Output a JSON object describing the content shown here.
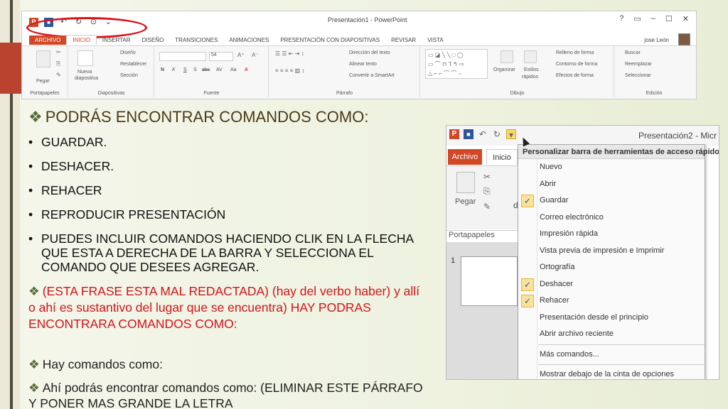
{
  "ribbon": {
    "qat_icons": [
      "ppt-icon",
      "save-icon",
      "undo-icon",
      "redo-icon",
      "present-icon",
      "customize-icon"
    ],
    "doc_title": "Presentación1 - PowerPoint",
    "window_controls": [
      "?",
      "▭",
      "–",
      "☐",
      "✕"
    ],
    "tabs": [
      "ARCHIVO",
      "INICIO",
      "INSERTAR",
      "DISEÑO",
      "TRANSICIONES",
      "ANIMACIONES",
      "PRESENTACIÓN CON DIAPOSITIVAS",
      "REVISAR",
      "VISTA"
    ],
    "user": "jose León",
    "groups": {
      "portapapeles": "Portapapeles",
      "diapositivas": "Diapositivas",
      "fuente": "Fuente",
      "parrafo": "Párrafo",
      "dibujo": "Dibujo",
      "edicion": "Edición"
    },
    "buttons": {
      "pegar": "Pegar",
      "nueva": "Nueva",
      "diapositiva": "diapositiva",
      "diseno": "Diseño",
      "restablecer": "Restablecer",
      "seccion": "Sección",
      "font_size": "54",
      "direccion": "Dirección del texto",
      "alinear": "Alinear texto",
      "smartart": "Convertir a SmartArt",
      "organizar": "Organizar",
      "estilos": "Estilos",
      "rapidos": "rápidos",
      "relleno": "Relleno de forma",
      "contorno": "Contorno de forma",
      "efectos": "Efectos de forma",
      "buscar": "Buscar",
      "reemplazar": "Reemplazar",
      "seleccionar": "Seleccionar"
    },
    "font_tools": [
      "N",
      "K",
      "S",
      "S",
      "abc",
      "AV",
      "Aa",
      "A"
    ]
  },
  "heading": "PODRÁS ENCONTRAR COMANDOS COMO:",
  "bullets": [
    "GUARDAR.",
    "DESHACER.",
    "REHACER",
    "REPRODUCIR PRESENTACIÓN",
    "PUEDES INCLUIR COMANDOS HACIENDO CLIK EN LA FLECHA QUE ESTA A DERECHA DE LA BARRA  Y SELECCIONA EL COMANDO QUE DESEES AGREGAR."
  ],
  "note": "(ESTA FRASE ESTA MAL REDACTADA) (hay del verbo haber) y allí o ahí es sustantivo del lugar que se encuentra) HAY PODRAS ENCONTRARA COMANDOS COMO:",
  "line_hay": "Hay comandos como:",
  "line_ahi": "Ahí podrás encontrar comandos como: (ELIMINAR ESTE PÁRRAFO Y PONER MAS GRANDE LA LETRA",
  "shot": {
    "title": "Presentación2 - Micr",
    "tab_archivo": "Archivo",
    "tab_inicio": "Inicio",
    "pegar": "Pegar",
    "portapapeles": "Portapapeles",
    "slide_number": "1",
    "ribbon_letter": "d",
    "menu_title": "Personalizar barra de herramientas de acceso rápido",
    "menu_items": [
      {
        "label": "Nuevo",
        "checked": false
      },
      {
        "label": "Abrir",
        "checked": false
      },
      {
        "label": "Guardar",
        "checked": true
      },
      {
        "label": "Correo electrónico",
        "checked": false
      },
      {
        "label": "Impresión rápida",
        "checked": false
      },
      {
        "label": "Vista previa de impresión e Imprimir",
        "checked": false
      },
      {
        "label": "Ortografía",
        "checked": false
      },
      {
        "label": "Deshacer",
        "checked": true
      },
      {
        "label": "Rehacer",
        "checked": true
      },
      {
        "label": "Presentación desde el principio",
        "checked": false
      },
      {
        "label": "Abrir archivo reciente",
        "checked": false
      }
    ],
    "more_commands": "Más comandos...",
    "show_below": "Mostrar debajo de la cinta de opciones",
    "check_mark": "✓"
  },
  "colors": {
    "ppt_red": "#d24726",
    "annotation_red": "#d8161a",
    "check_bg": "#fbe29a"
  }
}
